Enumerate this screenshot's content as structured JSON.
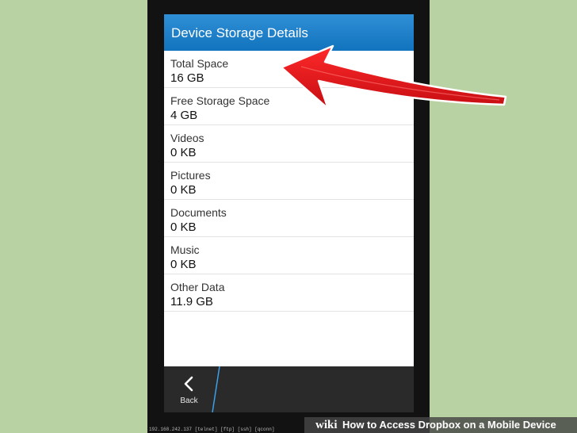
{
  "app": {
    "title": "Device Storage Details"
  },
  "storage": {
    "items": [
      {
        "label": "Total Space",
        "value": "16 GB"
      },
      {
        "label": "Free Storage Space",
        "value": "4 GB"
      },
      {
        "label": "Videos",
        "value": "0 KB"
      },
      {
        "label": "Pictures",
        "value": "0 KB"
      },
      {
        "label": "Documents",
        "value": "0 KB"
      },
      {
        "label": "Music",
        "value": "0 KB"
      },
      {
        "label": "Other Data",
        "value": "11.9 GB"
      }
    ]
  },
  "actionbar": {
    "back_label": "Back"
  },
  "statusline": {
    "text": "192.168.242.137    [telnet]  [ftp]  [ssh]  [qconn]"
  },
  "banner": {
    "wiki": "wiki",
    "howto_text": "How to Access Dropbox on a Mobile Device"
  },
  "colors": {
    "title_bar": "#1a7ccb",
    "arrow": "#e8161c",
    "background": "#b9d2a3",
    "action_bar": "#2a2a2a",
    "accent_divider": "#3aa0e8"
  },
  "icons": {
    "back": "chevron-left-icon",
    "pointer": "red-arrow-annotation"
  }
}
